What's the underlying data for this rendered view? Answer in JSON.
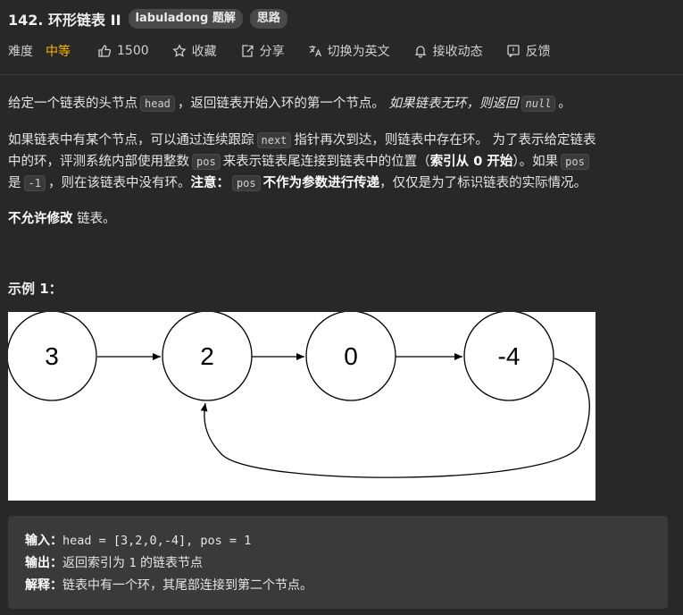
{
  "problem": {
    "title": "142. 环形链表 II",
    "tags": [
      "labuladong 题解",
      "思路"
    ]
  },
  "meta": {
    "difficulty_label": "难度",
    "difficulty_value": "中等",
    "likes": "1500",
    "favorite": "收藏",
    "share": "分享",
    "switch_lang": "切换为英文",
    "subscribe": "接收动态",
    "feedback": "反馈",
    "difficulty_color": "#ffb800"
  },
  "desc": {
    "p1_a": "给定一个链表的头节点",
    "p1_code": "head",
    "p1_b": "，返回链表开始入环的第一个节点。",
    "p1_c": "如果链表无环，则返回",
    "p1_code2": "null",
    "p1_d": "。",
    "p2_a": "如果链表中有某个节点，可以通过连续跟踪",
    "p2_code1": "next",
    "p2_b": "指针再次到达，则链表中存在环。 为了表示给定链表",
    "p2_c": "中的环，评测系统内部使用整数",
    "p2_code2": "pos",
    "p2_d": "来表示链表尾连接到链表中的位置（",
    "p2_bold1": "索引从 0 开始",
    "p2_e": "）。如果",
    "p2_code3": "pos",
    "p2_f": "是",
    "p2_code4": "-1",
    "p2_g": "，则在该链表中没有环。",
    "p2_bold2": "注意：",
    "p2_code5": "pos",
    "p2_bold3": "不作为参数进行传递",
    "p2_h": "，仅仅是为了标识链表的实际情况。",
    "p3_bold": "不允许修改",
    "p3_text": "链表。"
  },
  "example": {
    "title": "示例 1：",
    "nodes": [
      "3",
      "2",
      "0",
      "-4"
    ],
    "input_label": "输入：",
    "input_value": "head = [3,2,0,-4], pos = 1",
    "output_label": "输出：",
    "output_a": "返回索引为",
    "output_code": "1",
    "output_b": "的链表节点",
    "explain_label": "解释：",
    "explain_value": "链表中有一个环，其尾部连接到第二个节点。"
  }
}
